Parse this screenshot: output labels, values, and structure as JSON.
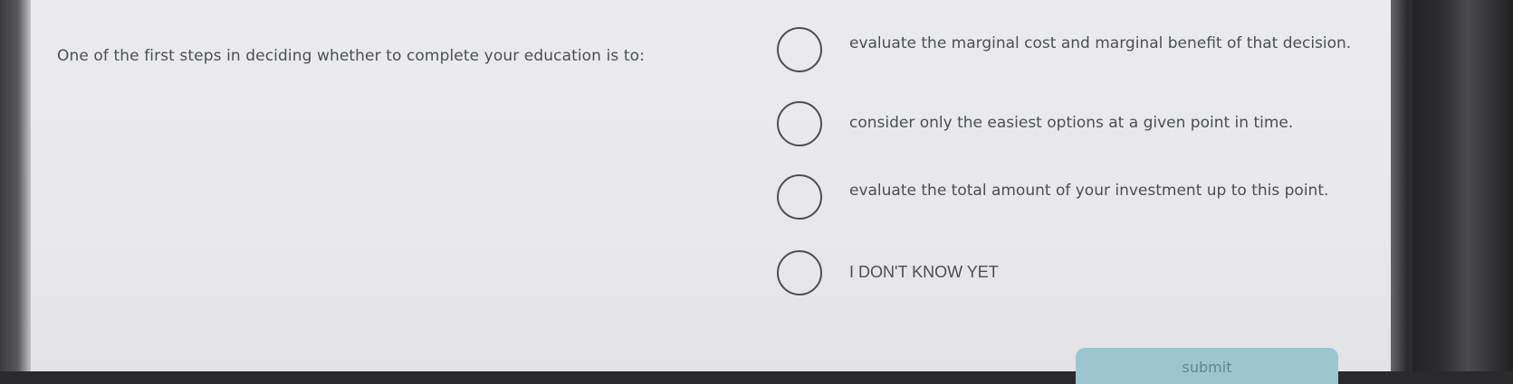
{
  "question": {
    "text": "One of the first steps in deciding whether to complete your education is to:"
  },
  "options": [
    {
      "label": "evaluate the marginal cost and marginal benefit of that decision.",
      "selected": false
    },
    {
      "label": "consider only the easiest options at a given point in time.",
      "selected": false
    },
    {
      "label": "evaluate the total amount of your investment up to this point.",
      "selected": false
    },
    {
      "label": "I DON'T KNOW YET",
      "selected": false
    }
  ],
  "submit": {
    "label": "submit"
  },
  "colors": {
    "text": "#4a4f57",
    "page_background": "#ebebed",
    "submit_background": "#9cc5cf"
  }
}
